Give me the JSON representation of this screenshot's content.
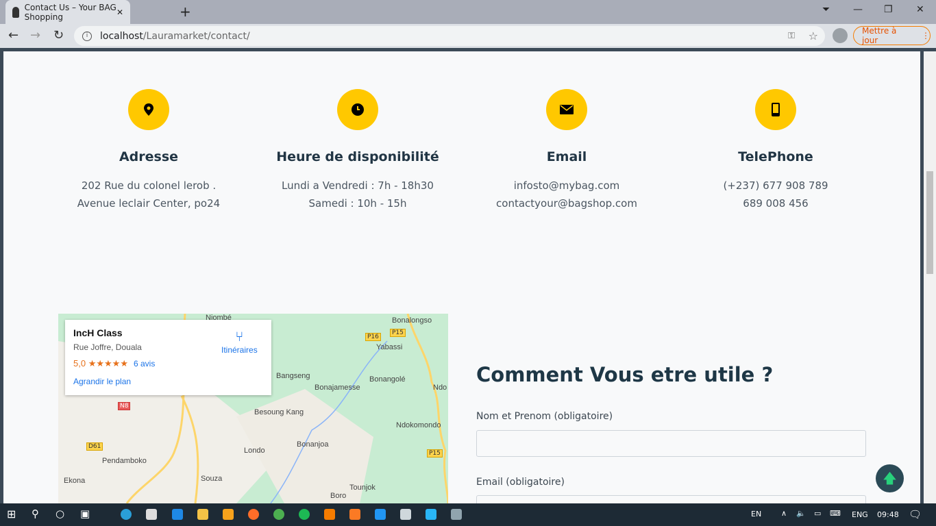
{
  "browser": {
    "tab_title": "Contact Us – Your BAG Shopping",
    "url_host": "localhost",
    "url_path": "/Lauramarket/contact/",
    "update_label": "Mettre à jour"
  },
  "info": [
    {
      "icon": "map-marker-icon",
      "title": "Adresse",
      "lines": [
        "202 Rue du colonel lerob .",
        "Avenue leclair Center, po24"
      ]
    },
    {
      "icon": "clock-icon",
      "title": "Heure de disponibilité",
      "lines": [
        "Lundi a Vendredi : 7h - 18h30",
        "Samedi : 10h - 15h"
      ]
    },
    {
      "icon": "envelope-icon",
      "title": "Email",
      "lines": [
        "infosto@mybag.com",
        "contactyour@bagshop.com"
      ]
    },
    {
      "icon": "mobile-phone-icon",
      "title": "TelePhone",
      "lines": [
        "(+237) 677 908 789",
        "689 008 456"
      ]
    }
  ],
  "map": {
    "name": "IncH Class",
    "address": "Rue Joffre, Douala",
    "rating": "5,0",
    "stars": "★★★★★",
    "reviews": "6 avis",
    "enlarge": "Agrandir le plan",
    "directions": "Itinéraires",
    "places": [
      "Njombé",
      "Bonalongso",
      "Yabassi",
      "Bangseng",
      "Bonajamesse",
      "Bonangolé",
      "Ndo",
      "Besoung Kang",
      "Ndokomondo",
      "Pendamboko",
      "Londo",
      "Bonanjoa",
      "Ekona",
      "Souza",
      "Tounjok",
      "Boro"
    ],
    "roads": [
      "P16",
      "P15",
      "N8",
      "D61",
      "P15"
    ]
  },
  "form": {
    "heading": "Comment Vous etre utile ?",
    "name_label": "Nom et Prenom (obligatoire)",
    "email_label": "Email (obligatoire)"
  },
  "taskbar": {
    "lang": "EN",
    "lang2": "ENG",
    "time": "09:48"
  },
  "colors": {
    "accent": "#ffc800",
    "heading": "#1e3746",
    "back_to_top": "#2b4a56"
  }
}
